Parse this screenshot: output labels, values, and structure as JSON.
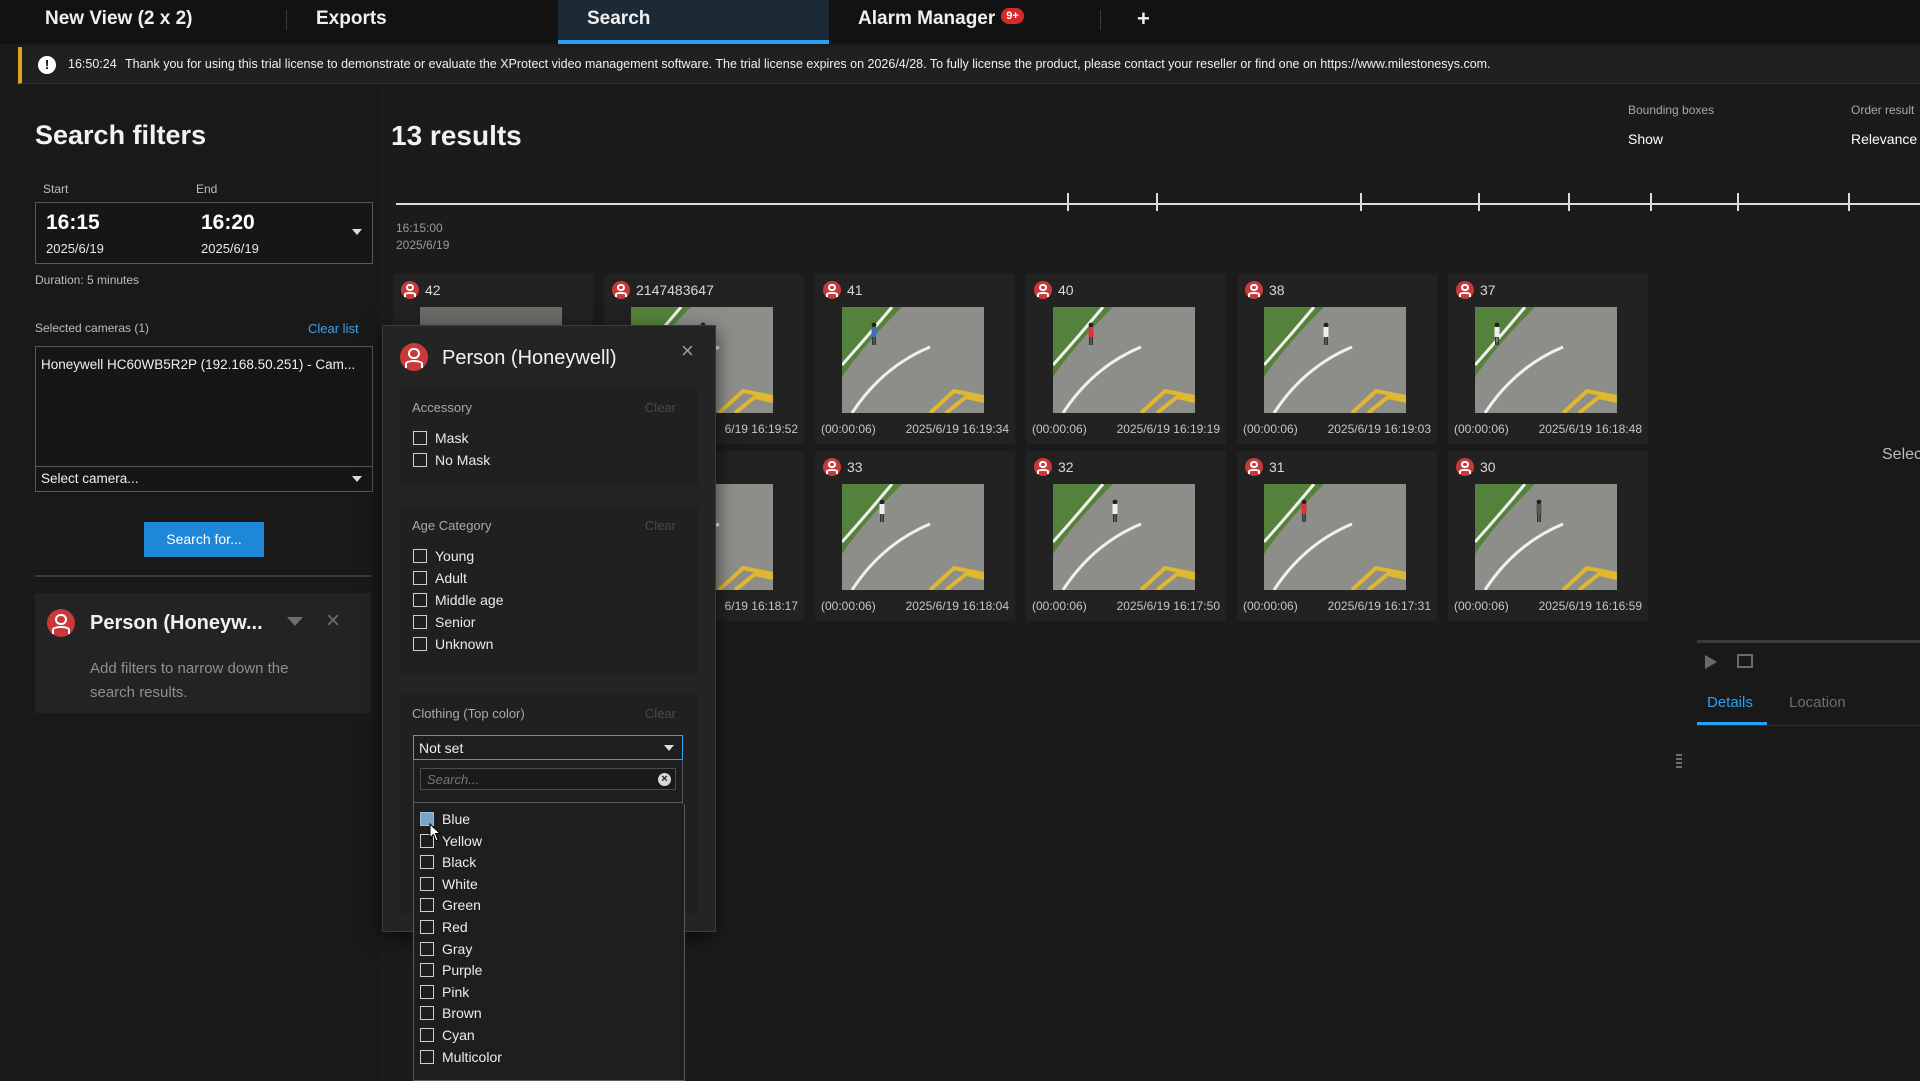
{
  "tabs": [
    {
      "label": "New View (2 x 2)"
    },
    {
      "label": "Exports"
    },
    {
      "label": "Search"
    },
    {
      "label": "Alarm Manager",
      "badge": "9+"
    },
    {
      "label": "+"
    }
  ],
  "notice": {
    "time": "16:50:24",
    "message": "Thank you for using this trial license to demonstrate or evaluate the XProtect video management software. The trial license expires on 2026/4/28. To fully license the product, please contact your reseller or find one on https://www.milestonesys.com."
  },
  "filters": {
    "title": "Search filters",
    "start_label": "Start",
    "end_label": "End",
    "start_time": "16:15",
    "start_date": "2025/6/19",
    "end_time": "16:20",
    "end_date": "2025/6/19",
    "duration": "Duration: 5 minutes",
    "selected_cameras_label": "Selected cameras (1)",
    "clear_list": "Clear list",
    "camera_entry": "Honeywell HC60WB5R2P (192.168.50.251) - Cam...",
    "select_camera": "Select camera...",
    "search_button": "Search for...",
    "person_card_title": "Person (Honeyw...",
    "person_card_hint": "Add filters to narrow down the search results."
  },
  "results": {
    "title": "13 results",
    "bounding_label": "Bounding boxes",
    "bounding_value": "Show",
    "order_label": "Order result",
    "order_value": "Relevance",
    "timeline_time": "16:15:00",
    "timeline_date": "2025/6/19",
    "row1": [
      {
        "num": "42",
        "dur": "",
        "ts": ""
      },
      {
        "num": "2147483647",
        "dur": "",
        "ts": "6/19 16:19:52"
      },
      {
        "num": "41",
        "dur": "(00:00:06)",
        "ts": "2025/6/19 16:19:34"
      },
      {
        "num": "40",
        "dur": "(00:00:06)",
        "ts": "2025/6/19 16:19:19"
      },
      {
        "num": "38",
        "dur": "(00:00:06)",
        "ts": "2025/6/19 16:19:03"
      },
      {
        "num": "37",
        "dur": "(00:00:06)",
        "ts": "2025/6/19 16:18:48"
      }
    ],
    "row2": [
      {
        "num": "",
        "dur": "",
        "ts": "6/19 16:18:17"
      },
      {
        "num": "33",
        "dur": "(00:00:06)",
        "ts": "2025/6/19 16:18:04"
      },
      {
        "num": "32",
        "dur": "(00:00:06)",
        "ts": "2025/6/19 16:17:50"
      },
      {
        "num": "31",
        "dur": "(00:00:06)",
        "ts": "2025/6/19 16:17:31"
      },
      {
        "num": "30",
        "dur": "(00:00:06)",
        "ts": "2025/6/19 16:16:59"
      }
    ]
  },
  "popup": {
    "title": "Person (Honeywell)",
    "accessory": {
      "title": "Accessory",
      "clear": "Clear",
      "items": [
        "Mask",
        "No Mask"
      ]
    },
    "age": {
      "title": "Age Category",
      "clear": "Clear",
      "items": [
        "Young",
        "Adult",
        "Middle age",
        "Senior",
        "Unknown"
      ]
    },
    "clothing": {
      "title": "Clothing (Top color)",
      "clear": "Clear",
      "selected": "Not set",
      "search_placeholder": "Search...",
      "options": [
        "Blue",
        "Yellow",
        "Black",
        "White",
        "Green",
        "Red",
        "Gray",
        "Purple",
        "Pink",
        "Brown",
        "Cyan",
        "Multicolor"
      ]
    }
  },
  "right": {
    "select_text": "Selec",
    "tab_details": "Details",
    "tab_location": "Location"
  },
  "colors": {
    "accent": "#2b9ff0",
    "person_red": "#c83a3a",
    "warning": "#e2a21b"
  }
}
